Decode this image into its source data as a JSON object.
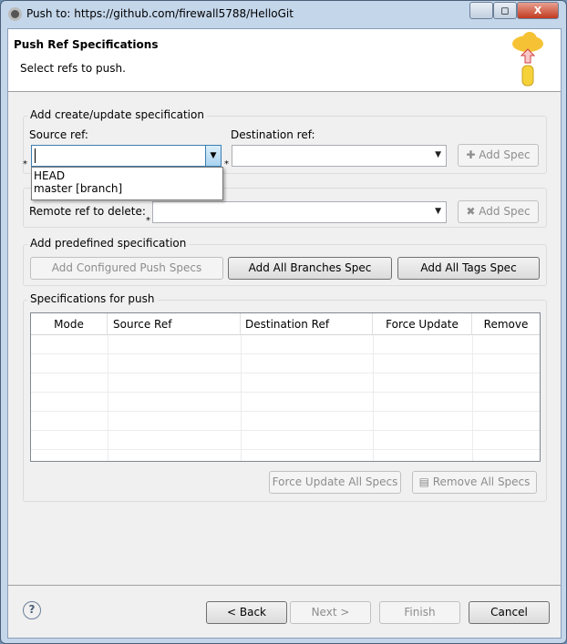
{
  "window": {
    "title": "Push to: https://github.com/firewall5788/HelloGit",
    "minimize": "▭",
    "maximize": "◻",
    "close": "X"
  },
  "header": {
    "title": "Push Ref Specifications",
    "subtitle": "Select refs to push.",
    "icon": "cloud-push-icon"
  },
  "create_group": {
    "label": "Add create/update specification",
    "source_label": "Source ref:",
    "source_value": "",
    "dest_label": "Destination ref:",
    "dest_value": "",
    "add_spec": "Add Spec",
    "required_mark": "*"
  },
  "source_dropdown": {
    "options": [
      "HEAD",
      "master [branch]"
    ]
  },
  "delete_group": {
    "remote_label": "Remote ref to delete:",
    "remote_value": "",
    "add_spec": "Add Spec"
  },
  "predefined": {
    "label": "Add predefined specification",
    "configured": "Add Configured Push Specs",
    "branches": "Add All Branches Spec",
    "tags": "Add All Tags Spec"
  },
  "specs": {
    "label": "Specifications for push",
    "columns": [
      "Mode",
      "Source Ref",
      "Destination Ref",
      "Force Update",
      "Remove"
    ],
    "rows": [],
    "force_all": "Force Update All Specs",
    "remove_all": "Remove All Specs"
  },
  "footer": {
    "back": "< Back",
    "next": "Next >",
    "finish": "Finish",
    "cancel": "Cancel"
  }
}
